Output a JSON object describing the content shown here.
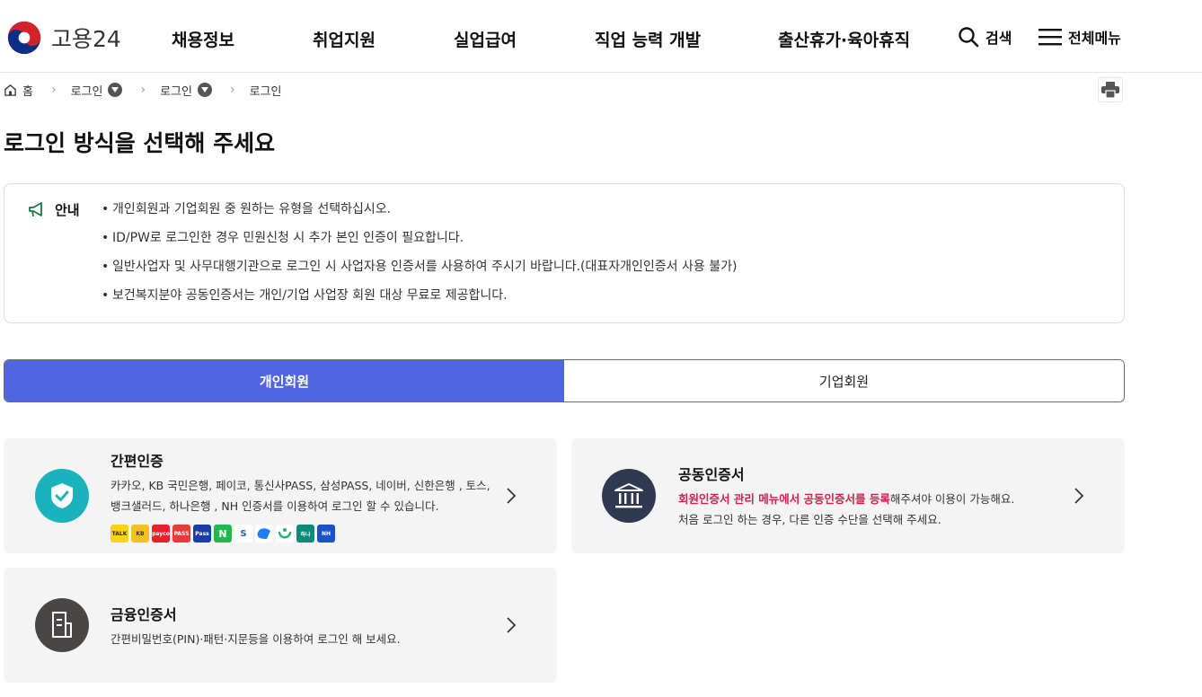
{
  "header": {
    "logo_text": "고용24",
    "nav": [
      "채용정보",
      "취업지원",
      "실업급여",
      "직업 능력 개발",
      "출산휴가·육아휴직"
    ],
    "search_label": "검색",
    "menu_label": "전체메뉴"
  },
  "breadcrumb": {
    "home": "홈",
    "items": [
      "로그인",
      "로그인",
      "로그인"
    ]
  },
  "page_title": "로그인 방식을 선택해 주세요",
  "notice": {
    "title": "안내",
    "items": [
      "개인회원과 기업회원 중 원하는 유형을 선택하십시오.",
      "ID/PW로 로그인한 경우 민원신청 시 추가 본인 인증이 필요합니다.",
      "일반사업자 및 사무대행기관으로 로그인 시 사업자용 인증서를 사용하여 주시기 바랍니다.(대표자개인인증서 사용 불가)",
      "보건복지분야 공동인증서는 개인/기업 사업장 회원 대상 무료로 제공합니다."
    ]
  },
  "tabs": [
    "개인회원",
    "기업회원"
  ],
  "cards": {
    "simple": {
      "title": "간편인증",
      "desc_line1": "카카오, KB 국민은행, 페이코, 통신사PASS, 삼성PASS, 네이버, 신한은행 , 토스,",
      "desc_line2": "뱅크샐러드, 하나은행 , NH 인증서를 이용하여 로그인 할 수 있습니다.",
      "providers": [
        {
          "label": "TALK",
          "color": "#f7d417",
          "icon": "kakao-icon"
        },
        {
          "label": "KB",
          "color": "#f2c224",
          "icon": "kb-icon"
        },
        {
          "label": "payco",
          "color": "#e8202a",
          "icon": "payco-icon"
        },
        {
          "label": "PASS",
          "color": "#e43b3b",
          "icon": "pass-icon"
        },
        {
          "label": "Pass",
          "color": "#1a3ea8",
          "icon": "samsung-pass-icon"
        },
        {
          "label": "N",
          "color": "#1fb84e",
          "icon": "naver-icon"
        },
        {
          "label": "S",
          "color": "#ffffff",
          "icon": "shinhan-icon"
        },
        {
          "label": "",
          "color": "#ffffff",
          "icon": "toss-icon"
        },
        {
          "label": "",
          "color": "#ffffff",
          "icon": "banksalad-icon"
        },
        {
          "label": "하나",
          "color": "#0c8a7a",
          "icon": "hana-icon"
        },
        {
          "label": "NH",
          "color": "#1b52c6",
          "icon": "nh-icon"
        }
      ]
    },
    "joint": {
      "title": "공동인증서",
      "desc_hl": "회원인증서 관리 메뉴에서 공동인증서를 등록",
      "desc_rest": "해주셔야 이용이 가능해요.",
      "desc_line2": "처음 로그인 하는 경우, 다른 인증 수단을 선택해 주세요."
    },
    "finance": {
      "title": "금융인증서",
      "desc": "간편비밀번호(PIN)·패턴·지문등을 이용하여 로그인 해 보세요."
    }
  },
  "colors": {
    "tab_active": "#4f66e0",
    "simple_icon": "#1ab2bd",
    "joint_icon": "#2f3a52",
    "finance_icon": "#4b4646",
    "highlight": "#d6204e"
  }
}
